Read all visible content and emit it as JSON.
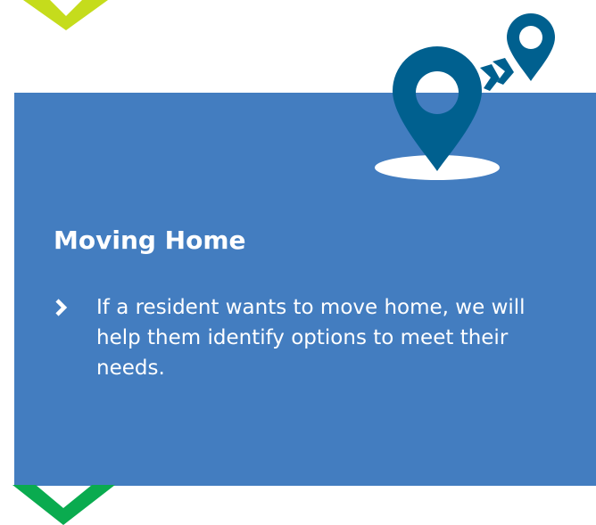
{
  "section": {
    "title": "Moving Home",
    "bullets": [
      "If a resident wants to move home, we will help them identify options to meet their needs."
    ]
  },
  "icons": {
    "pin_graphic": "location-pins-icon",
    "bullet": "chevron-right-icon",
    "decorative_top": "chevron-down-icon",
    "decorative_bottom": "chevron-down-icon"
  },
  "colors": {
    "panel": "#437dc0",
    "pin": "#00608f",
    "text": "#ffffff",
    "top_chevron": "#c5dc1c",
    "bottom_chevron": "#0aab4f"
  }
}
